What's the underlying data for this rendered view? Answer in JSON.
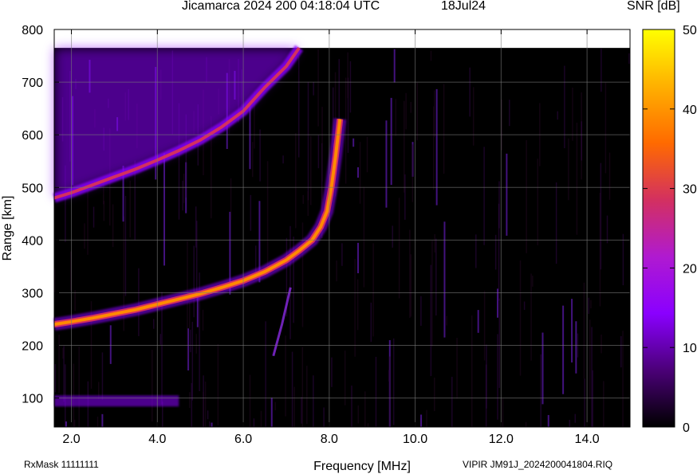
{
  "title": "Jicamarca 2024 200 04:18:04 UTC",
  "date": "18Jul24",
  "footer": {
    "left": "RxMask 11111111",
    "right": "VIPIR  JM91J_2024200041804.RIQ"
  },
  "colors": {
    "background": "#000000",
    "grid": "#7a7a7a",
    "band_purple": "#8a00ff",
    "band_orange": "#ff8a00"
  },
  "chart_data": {
    "type": "heatmap",
    "title": "Jicamarca 2024 200 04:18:04 UTC",
    "xlabel": "Frequency [MHz]",
    "ylabel": "Range [km]",
    "xlim": [
      1.6,
      15.0
    ],
    "ylim": [
      45,
      800
    ],
    "data_ylim_top": 765,
    "xticks": [
      "2.0",
      "4.0",
      "6.0",
      "8.0",
      "10.0",
      "12.0",
      "14.0"
    ],
    "xtick_values": [
      2,
      4,
      6,
      8,
      10,
      12,
      14
    ],
    "yticks": [
      "100",
      "200",
      "300",
      "400",
      "500",
      "600",
      "700",
      "800"
    ],
    "ytick_values": [
      100,
      200,
      300,
      400,
      500,
      600,
      700,
      800
    ],
    "grid": true,
    "colorbar": {
      "label": "SNR [dB]",
      "range": [
        0,
        50
      ],
      "ticks": [
        "0",
        "10",
        "20",
        "30",
        "40",
        "50"
      ],
      "tick_values": [
        0,
        10,
        20,
        30,
        40,
        50
      ],
      "colors": [
        "#000000",
        "#4b0078",
        "#8a00ff",
        "#b01ad0",
        "#d33060",
        "#ff6a00",
        "#ffb000",
        "#ffff00"
      ]
    },
    "traces": [
      {
        "name": "F-region trace",
        "frequency": [
          1.6,
          2.0,
          2.5,
          3.0,
          3.5,
          4.0,
          4.5,
          5.0,
          5.5,
          6.0,
          6.5,
          7.0,
          7.3,
          7.6,
          7.8,
          7.95,
          8.05,
          8.15,
          8.25
        ],
        "range": [
          240,
          245,
          252,
          260,
          268,
          278,
          288,
          298,
          310,
          323,
          340,
          362,
          380,
          400,
          425,
          455,
          500,
          560,
          630
        ],
        "snr_db": 35
      },
      {
        "name": "Second-hop trace",
        "frequency": [
          1.6,
          2.0,
          2.5,
          3.0,
          3.5,
          4.0,
          4.5,
          5.0,
          5.5,
          6.0,
          6.5,
          7.0,
          7.3
        ],
        "range": [
          480,
          490,
          505,
          520,
          535,
          552,
          570,
          590,
          615,
          645,
          690,
          730,
          765
        ],
        "snr_db": 28
      },
      {
        "name": "Oblique streak",
        "frequency": [
          6.7,
          6.9,
          7.1
        ],
        "range": [
          180,
          240,
          310
        ],
        "snr_db": 12
      },
      {
        "name": "Low-range echo",
        "frequency": [
          1.6,
          3.0,
          4.5
        ],
        "range": [
          93,
          93,
          93
        ],
        "snr_db": 14
      }
    ]
  }
}
